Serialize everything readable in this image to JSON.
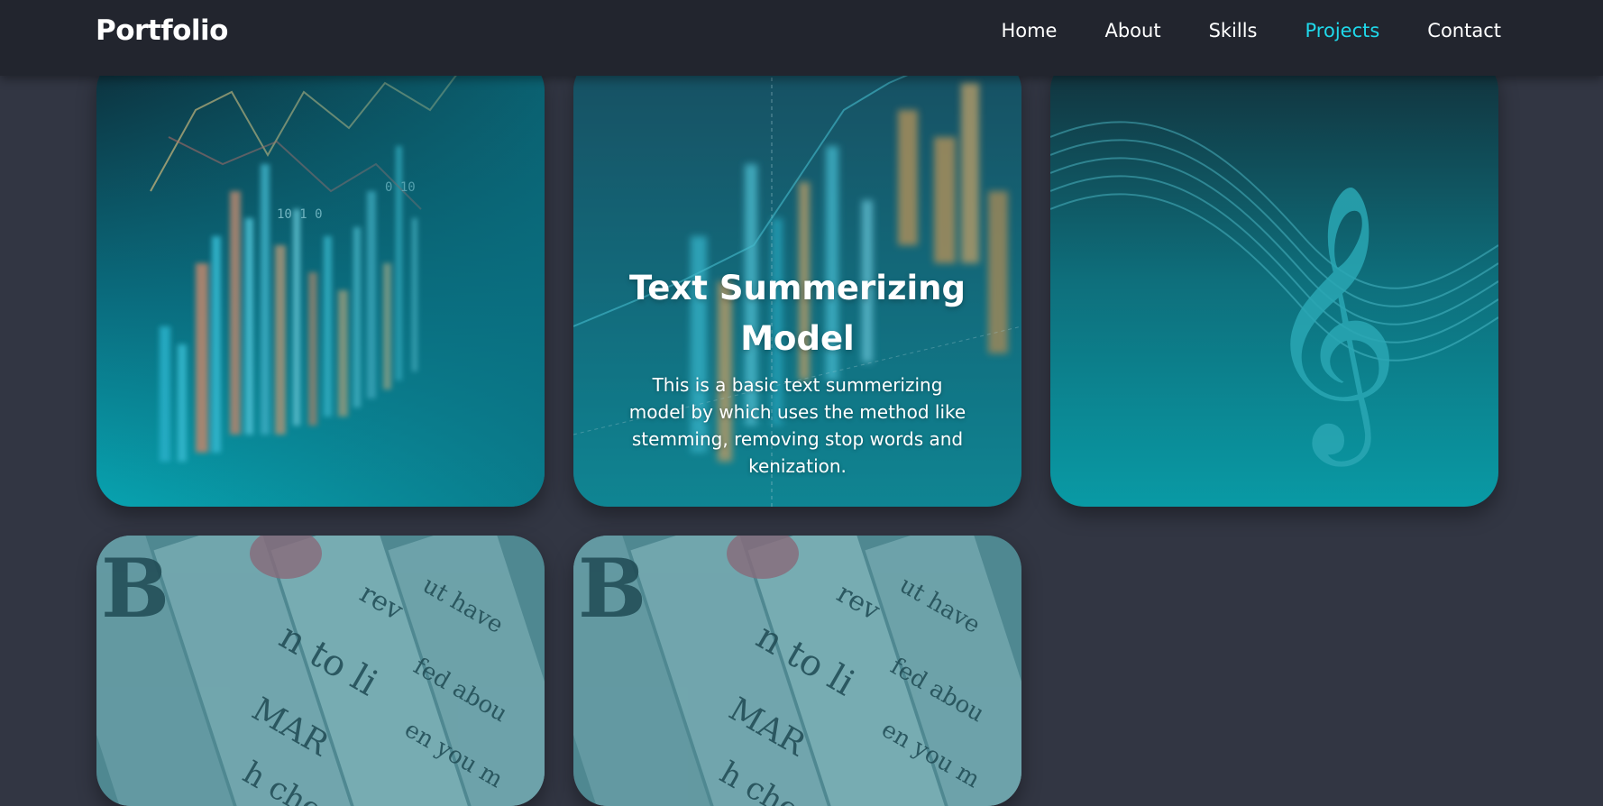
{
  "navbar": {
    "brand": "Portfolio",
    "links": [
      {
        "label": "Home",
        "active": false
      },
      {
        "label": "About",
        "active": false
      },
      {
        "label": "Skills",
        "active": false
      },
      {
        "label": "Projects",
        "active": true
      },
      {
        "label": "Contact",
        "active": false
      }
    ]
  },
  "colors": {
    "page_bg": "#323643",
    "navbar_bg": "#22252e",
    "accent": "#1fd8ea",
    "card_teal": "#0a9aa6"
  },
  "projects": [
    {
      "image": "stock-chart-image"
    },
    {
      "image": "stock-chart-image",
      "title": "Text Summerizing Model",
      "description": "This is a basic text summerizing model by which uses the method like stemming, removing stop words and kenization."
    },
    {
      "image": "music-clef-image"
    },
    {
      "image": "newspaper-image"
    },
    {
      "image": "newspaper-image"
    }
  ]
}
